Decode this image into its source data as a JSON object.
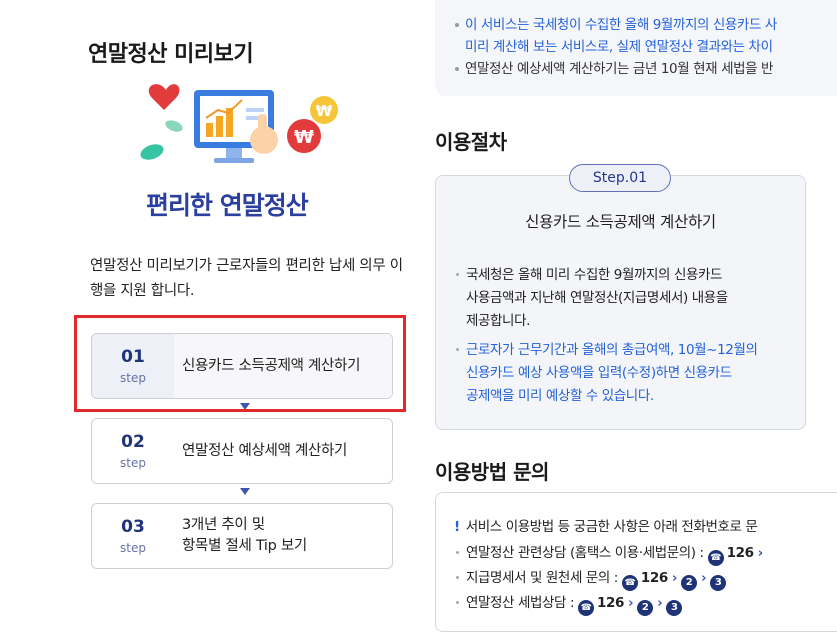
{
  "left": {
    "title": "연말정산 미리보기",
    "hero_caption": "편리한 연말정산",
    "intro": "연말정산 미리보기가 근로자들의  편리한 납세 의무 이행을 지원 합니다.",
    "steps": [
      {
        "num": "01",
        "label": "step",
        "text": "신용카드 소득공제액 계산하기"
      },
      {
        "num": "02",
        "label": "step",
        "text": "연말정산 예상세액 계산하기"
      },
      {
        "num": "03",
        "label": "step",
        "text_line1": "3개년 추이 및",
        "text_line2": "항목별 절세 Tip 보기"
      }
    ],
    "hero_coin_symbol": "₩"
  },
  "right": {
    "notice": {
      "line1": "이 서비스는 국세청이 수집한 올해 9월까지의 신용카드 사",
      "line2": "미리 계산해 보는 서비스로, 실제 연말정산 결과와는 차이",
      "line3": "연말정산 예상세액 계산하기는 금년 10월 현재 세법을 반"
    },
    "procedure": {
      "title": "이용절차",
      "step_pill": "Step.01",
      "step_title": "신용카드 소득공제액 계산하기",
      "item1_l1": "국세청은 올해 미리 수집한 9월까지의 신용카드",
      "item1_l2": "사용금액과 지난해 연말정산(지급명세서) 내용을",
      "item1_l3": "제공합니다.",
      "item2_l1": "근로자가 근무기간과 올해의 총급여액, 10월~12월의",
      "item2_l2": "신용카드 예상 사용액을 입력(수정)하면 신용카드",
      "item2_l3": "공제액을 미리 예상할 수 있습니다."
    },
    "inquiry": {
      "title": "이용방법 문의",
      "head": "서비스 이용방법 등 궁금한 사항은 아래 전화번호로 문",
      "rows": [
        {
          "label": "연말정산 관련상담 (홈택스 이용·세법문의) :",
          "phone": "126",
          "extra": ""
        },
        {
          "label": "지급명세서 및 원천세 문의 :",
          "phone": "126",
          "n1": "2",
          "n2": "3"
        },
        {
          "label": "연말정산 세법상담 :",
          "phone": "126",
          "n1": "2",
          "n2": "3"
        }
      ]
    }
  },
  "colors": {
    "accent_blue": "#2462d8",
    "navy": "#1f3477",
    "highlight_red": "#e32a2a"
  }
}
